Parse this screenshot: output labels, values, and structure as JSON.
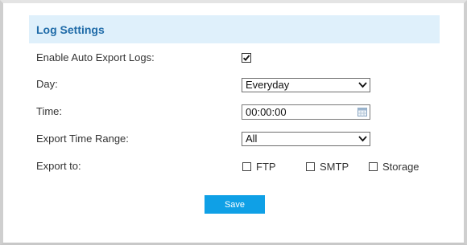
{
  "panel": {
    "title": "Log Settings"
  },
  "form": {
    "enable_auto_export": {
      "label": "Enable Auto Export Logs:",
      "checked": true
    },
    "day": {
      "label": "Day:",
      "value": "Everyday"
    },
    "time": {
      "label": "Time:",
      "value": "00:00:00"
    },
    "export_time_range": {
      "label": "Export Time Range:",
      "value": "All"
    },
    "export_to": {
      "label": "Export to:",
      "options": [
        {
          "label": "FTP",
          "checked": false
        },
        {
          "label": "SMTP",
          "checked": false
        },
        {
          "label": "Storage",
          "checked": false
        }
      ]
    }
  },
  "actions": {
    "save_label": "Save"
  },
  "colors": {
    "accent": "#0fa0e6",
    "header_bg": "#dff0fb",
    "header_text": "#1f6ba8"
  },
  "icons": {
    "dropdown": "chevron-down-icon",
    "time_picker": "calendar-icon",
    "checked": "checkmark-icon"
  }
}
